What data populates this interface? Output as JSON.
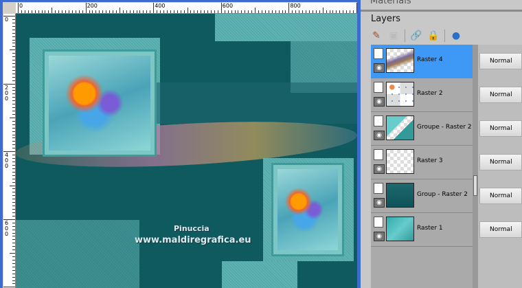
{
  "ruler": {
    "h_labels": [
      "0",
      "200",
      "400",
      "600",
      "800"
    ],
    "v_labels": [
      "0",
      "2\n0\n0",
      "4\n0\n0",
      "6\n0\n0"
    ]
  },
  "canvas": {
    "watermark_line1": "Pinuccia",
    "watermark_line2": "www.maldiregrafica.eu"
  },
  "panel": {
    "materials_title": "Materials",
    "layers_title": "Layers",
    "tools": [
      "paint-brush-icon",
      "mask-icon",
      "link-icon",
      "lock-icon",
      "blue-ball-icon"
    ],
    "layers": [
      {
        "name": "Raster 4",
        "blend": "Normal",
        "selected": true
      },
      {
        "name": "Raster 2",
        "blend": "Normal",
        "selected": false
      },
      {
        "name": "Groupe - Raster 2",
        "blend": "Normal",
        "selected": false
      },
      {
        "name": "Raster 3",
        "blend": "Normal",
        "selected": false
      },
      {
        "name": "Group - Raster 2",
        "blend": "Normal",
        "selected": false
      },
      {
        "name": "Raster 1",
        "blend": "Normal",
        "selected": false
      }
    ]
  }
}
